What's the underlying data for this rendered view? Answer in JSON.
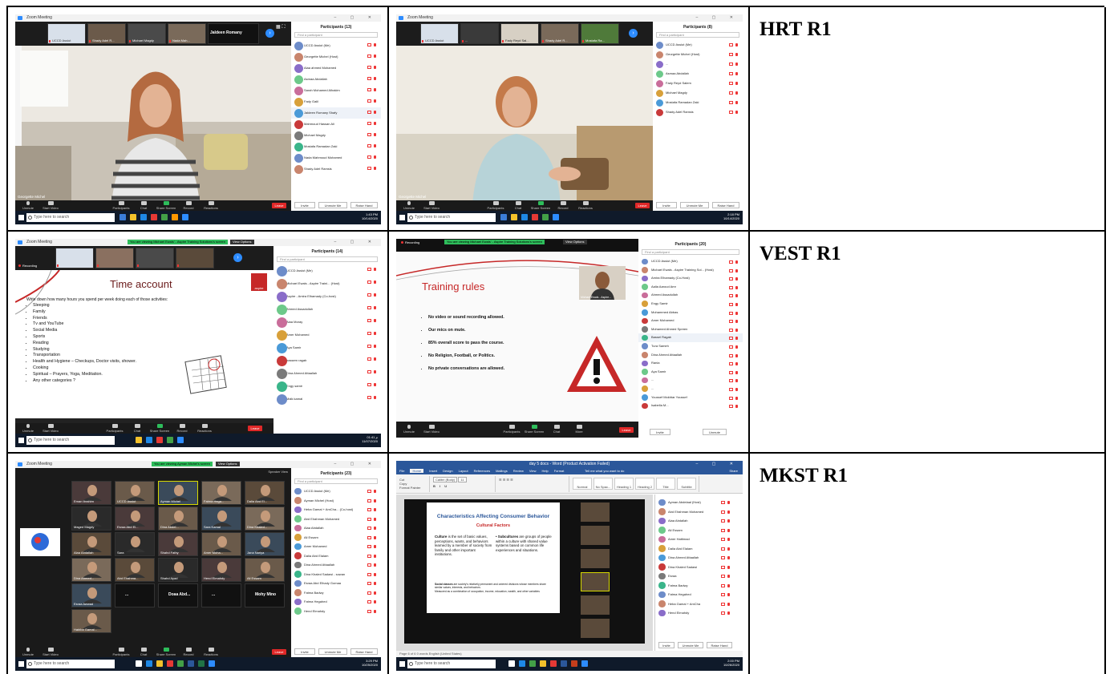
{
  "labels": {
    "row1": "HRT R1",
    "row2": "VEST R1",
    "row3": "MKST R1"
  },
  "common": {
    "app_title": "Zoom Meeting",
    "search_placeholder": "Type here to search",
    "find_participant": "Find a participant",
    "toolbar": {
      "unmute": "Unmute",
      "start_video": "Start Video",
      "participants": "Participants",
      "chat": "Chat",
      "share_screen": "Share Screen",
      "record": "Record",
      "reactions": "Reactions",
      "more": "More",
      "leave": "Leave"
    },
    "panel_footer": {
      "invite": "Invite",
      "unmute_me": "Unmute Me",
      "raise_hand": "Raise Hand"
    },
    "accent_blue": "#2d8cff",
    "leave_red": "#e02828",
    "share_green": "#2ebd5b"
  },
  "shot1": {
    "panel_title": "Participants (13)",
    "active_speaker": "Jaldeen Romany",
    "speaker_label": "Georgette Michel",
    "thumbs": [
      "UCCD Assiut",
      "Shady Adel R...",
      "Michael Magdy",
      "Nada Mah..."
    ],
    "participants": [
      "UCCD Assiut (Me)",
      "Georgette Michel (Host)",
      "Alaa ahmed Mohamed",
      "Asmaa Abdallah",
      "Sarah Mohamed Alhakim",
      "Fady Galil",
      "Jaldeen Romany Shafy",
      "Mahmoud Hassan Ali",
      "Michael Magdy",
      "Mostafa Ramadan Zaki",
      "Nada Mahmoud Mohamed",
      "Shady Adel Ramsis"
    ],
    "tray_time": "1:43 PM",
    "tray_date": "10/14/2020"
  },
  "shot2": {
    "panel_title": "Participants (8)",
    "speaker_label": "Georgette Michel",
    "thumbs": [
      "UCCD Assiut",
      "...",
      "Fady Reyd Sal...",
      "Shady Adel R...",
      "Mostafa Ra..."
    ],
    "participants": [
      "UCCD Assiut (Me)",
      "Georgette Michel (Host)",
      "...",
      "Asmaa Abdallah",
      "Fady Reyd Salem",
      "Michael Magdy",
      "Mostafa Ramadan Zaki",
      "Shady Adel Ramsis"
    ],
    "tray_time": "2:18 PM",
    "tray_date": "10/14/2020"
  },
  "shot3": {
    "panel_title": "Participants (14)",
    "notice": "You are viewing Michael Ewals' - Aspire Training Solutions's screen",
    "view_options": "View Options",
    "recording": "Recording",
    "slide_title": "Time account",
    "slide_intro": "Write down how many hours you spend per week doing each of those activities:",
    "slide_items": [
      "Sleeping",
      "Family",
      "Friends",
      "Tv and YouTube",
      "Social Media",
      "Sports",
      "Reading",
      "Studying",
      "Transportation",
      "Health and Hygiene – Checkups, Doctor visits, shower.",
      "Cooking",
      "Spiritual – Prayers, Yoga, Meditation.",
      "Any other categories ?"
    ],
    "brand": "aspire",
    "participants": [
      "UCCD Assiut (Me)",
      "Michael Ewals - Aspire Traini... (Host)",
      "Aspire - Amira Elhamady (Co-host)",
      "Ahmed Assadullah",
      "Alaa Moray",
      "Amer Mohamed",
      "Aya Samir",
      "bassem ragab",
      "Dina Ahmed Attaallah",
      "Engy samir",
      "Malk kamal"
    ],
    "tray_time": "01:41 م",
    "tray_date": "11/07/2020"
  },
  "shot4": {
    "panel_title": "Participants (20)",
    "notice": "You are viewing Michael Ewals' - Aspire Training Solutions's screen",
    "view_options": "View Options",
    "recording": "Recording",
    "slide_title": "Training rules",
    "rules": [
      "No video or sound recording allowed.",
      "Our mics on mute.",
      "85% overall score to pass the course.",
      "No Religion, Football, or Politics.",
      "No private conversations are allowed."
    ],
    "presenter_label": "Michael Ewals - Aspire...",
    "participants": [
      "UCCD Assiut (Me)",
      "Michael Ewals - Aspire Training Sol... (Host)",
      "Amira Elhamady (Co-Host)",
      "Aalia Aaroud Amr",
      "Ahmed Assadullah",
      "Engy Samir",
      "Mohammed Abbas",
      "Amer Mohamed",
      "Mohamed Ahmed Spreen",
      "Bassel Ragab",
      "Tura Sameh",
      "Dina Ahmed Attaallah",
      "Rania",
      "Aya Samir",
      "...",
      "...",
      "Youssef Mokhtar Youssef",
      "Isabella M..."
    ],
    "footer": [
      "Invite",
      "Unmute"
    ]
  },
  "shot5": {
    "panel_title": "Participants (23)",
    "notice": "You are viewing Ayman Michel's screen",
    "view_options": "View Options",
    "speaker_view": "Speaker View",
    "gallery": [
      "Eman Ibrahim",
      "UCCD Assiut",
      "Ayman Michel",
      "Fatma Hega...",
      "Dalia Abd El...",
      "Maged Magdy",
      "Esraa Abd El...",
      "Dina Abdel...",
      "Sara Kamal",
      "Dina Khaled...",
      "Alaa Abdallah",
      "Sara",
      "Shahd Fathy",
      "Amer Moha...",
      "Jana Nariya",
      "Dina Ahmed...",
      "Abd Elrahma...",
      "Shahd Ayad",
      "Hend Elmahdy",
      "Ali Essam",
      "Esraa Awwad",
      "...",
      "Doaa Abd...",
      "...",
      "Mohy Mino",
      "Habiba Gamal..."
    ],
    "participants": [
      "UCCD Assiut (Me)",
      "Ayman Michel (Host)",
      "Heba Gamal + AmCha... (Co-host)",
      "Abd Elrahman Mohamed",
      "Alaa Abdallah",
      "Ali Essam",
      "Amer Mohamed",
      "Dalia Abd Elalam",
      "Dina Ahmed Attaallah",
      "Dina Khaled Sadawi - sowan",
      "Esraa Abd Elhady Gomaa",
      "Fatma Badwy",
      "Fatma Hegahed",
      "Hend Elmahdy"
    ],
    "tray_time": "3:29 PM",
    "tray_date": "10/25/2020"
  },
  "shot6": {
    "window_title": "day 5 docs - Word (Product Activation Failed)",
    "ribbon_tabs": [
      "File",
      "Home",
      "Insert",
      "Design",
      "Layout",
      "References",
      "Mailings",
      "Review",
      "View",
      "Help",
      "Format"
    ],
    "tell_me": "Tell me what you want to do",
    "share": "Share",
    "font_name": "Calibri (Body)",
    "font_size": "11",
    "clipboard": [
      "Cut",
      "Copy",
      "Format Painter"
    ],
    "styles": [
      "Normal",
      "No Spac...",
      "Heading 1",
      "Heading 2",
      "Title",
      "Subtitle"
    ],
    "slide_title": "Characteristics Affecting Consumer Behavior",
    "slide_subtitle": "Cultural Factors",
    "culture_term": "Culture",
    "culture_text": "is the set of basic values, perceptions, wants, and behaviors learned by a member of society from family and other important institutions.",
    "subculture_term": "Subcultures",
    "subculture_text": "are groups of people within a culture with shared value systems based on common life experiences and situations.",
    "social_term": "Social classes",
    "social_text": "are society's relatively permanent and ordered divisions whose members share similar values, interests, and behaviors.",
    "social_text2": "Measured as a combination of occupation, income, education, wealth, and other variables",
    "participants": [
      "Ayman Abdelaal (Host)",
      "Abd Elrahman Mohamed",
      "Alaa Abdallah",
      "Ali Essam",
      "Amer Hattimad",
      "Dalia Abd Elalam",
      "Dina Ahmed Attaallah",
      "Dina Khaled Sadawi",
      "Esraa",
      "Fatma Badwy",
      "Fatma Hegahed",
      "Heba Gamal + AmCha",
      "Hend Elmahdy"
    ],
    "status_bar": "Page 6 of 6   0 words   English (United States)",
    "tray_time": "2:00 PM",
    "tray_date": "10/26/2020"
  }
}
